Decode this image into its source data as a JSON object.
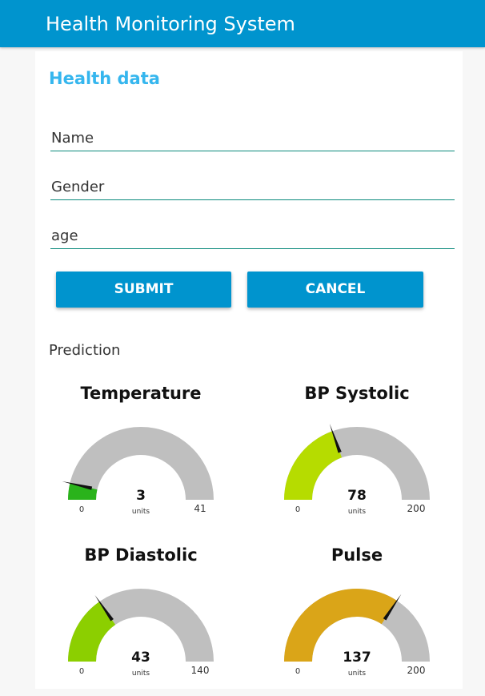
{
  "app": {
    "title": "Health Monitoring System"
  },
  "form": {
    "section_title": "Health data",
    "fields": [
      {
        "placeholder": "Name",
        "value": ""
      },
      {
        "placeholder": "Gender",
        "value": ""
      },
      {
        "placeholder": "age",
        "value": ""
      }
    ],
    "submit_label": "SUBMIT",
    "cancel_label": "CANCEL"
  },
  "prediction": {
    "label": "Prediction",
    "gauges": [
      {
        "title": "Temperature",
        "value": 3,
        "unit": "units",
        "min": 0,
        "max": 41,
        "color": "#2ab31b"
      },
      {
        "title": "BP Systolic",
        "value": 78,
        "unit": "units",
        "min": 0,
        "max": 200,
        "color": "#b6dc00"
      },
      {
        "title": "BP Diastolic",
        "value": 43,
        "unit": "units",
        "min": 0,
        "max": 140,
        "color": "#8ccf00"
      },
      {
        "title": "Pulse",
        "value": 137,
        "unit": "units",
        "min": 0,
        "max": 200,
        "color": "#daa518"
      }
    ]
  },
  "colors": {
    "header": "#0094ce",
    "accent": "#35b6ee",
    "gauge_track": "#bfbfbf",
    "needle": "#111111"
  }
}
